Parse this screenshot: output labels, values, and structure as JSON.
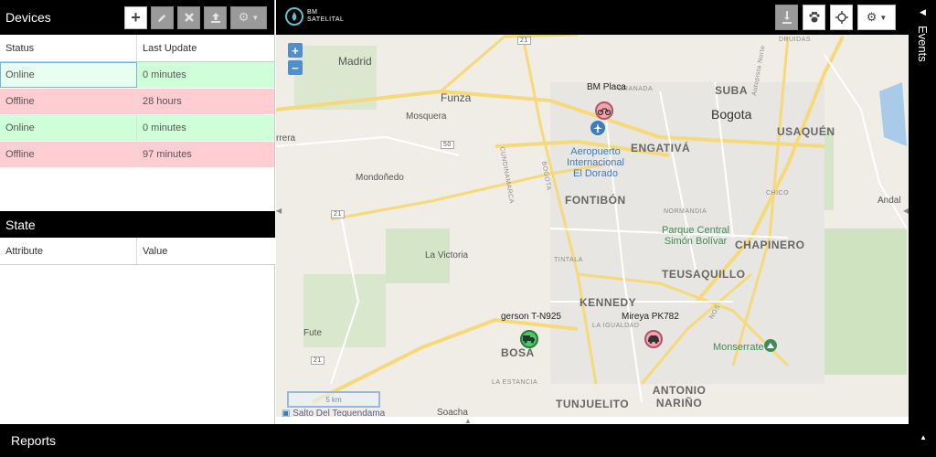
{
  "devices": {
    "title": "Devices",
    "columns": [
      "Status",
      "Last Update"
    ],
    "rows": [
      {
        "status": "Online",
        "last_update": "0 minutes"
      },
      {
        "status": "Offline",
        "last_update": "28 hours"
      },
      {
        "status": "Online",
        "last_update": "0 minutes"
      },
      {
        "status": "Offline",
        "last_update": "97 minutes"
      }
    ]
  },
  "state": {
    "title": "State",
    "columns": [
      "Attribute",
      "Value"
    ]
  },
  "logo": {
    "line1": "BM",
    "line2": "SATELITAL"
  },
  "map": {
    "zoom_in": "+",
    "zoom_out": "−",
    "places": {
      "madrid": "Madrid",
      "funza": "Funza",
      "mosquera": "Mosquera",
      "mondonedo": "Mondoñedo",
      "la_victoria": "La Victoria",
      "fute": "Fute",
      "rrera": "rrera",
      "suba": "SUBA",
      "bogota": "Bogota",
      "engativa": "ENGATIVÁ",
      "usaquen": "USAQUÉN",
      "fontibon": "FONTIBÓN",
      "chapinero": "CHAPINERO",
      "teusaquillo": "TEUSAQUILLO",
      "kennedy": "KENNEDY",
      "bosa": "BOSA",
      "tunjuelito": "TUNJUELITO",
      "antonio_narino": "ANTONIO NARIÑO",
      "soacha": "Soacha",
      "andal": "Andal",
      "airport": [
        "Aeropuerto",
        "Internacional",
        "El Dorado"
      ],
      "park": [
        "Parque Central",
        "Simón Bolívar"
      ],
      "monserrate": "Monserrate",
      "granada": "GRANADA",
      "cundinamarca": "CUNDINAMARCA",
      "bogota_road": "BOGOTA",
      "normandia": "NORMANDIA",
      "tintala": "TINTALA",
      "la_igualdad": "LA IGUALDAD",
      "la_estancia": "LA ESTANCIA",
      "chico": "CHICO",
      "nos": "NOS",
      "autopista": "Autopista Norte",
      "druidas": "DRUIDAS",
      "salto": "Salto Del Tequendama",
      "r50": "50",
      "r21a": "21",
      "r21b": "21",
      "r21c": "21"
    },
    "markers": [
      {
        "label": "BM Placa",
        "color": "red",
        "icon": "motorcycle-icon"
      },
      {
        "label": "gerson  T-N925",
        "color": "green",
        "icon": "truck-icon"
      },
      {
        "label": "Mireya  PK782",
        "color": "red",
        "icon": "car-icon"
      }
    ],
    "scale": "5 km"
  },
  "events": {
    "title": "Events"
  },
  "reports": {
    "title": "Reports"
  },
  "colors": {
    "online": "#cfffd9",
    "offline": "#ffcdd2",
    "header": "#000000",
    "accent": "#4f8fd0"
  }
}
